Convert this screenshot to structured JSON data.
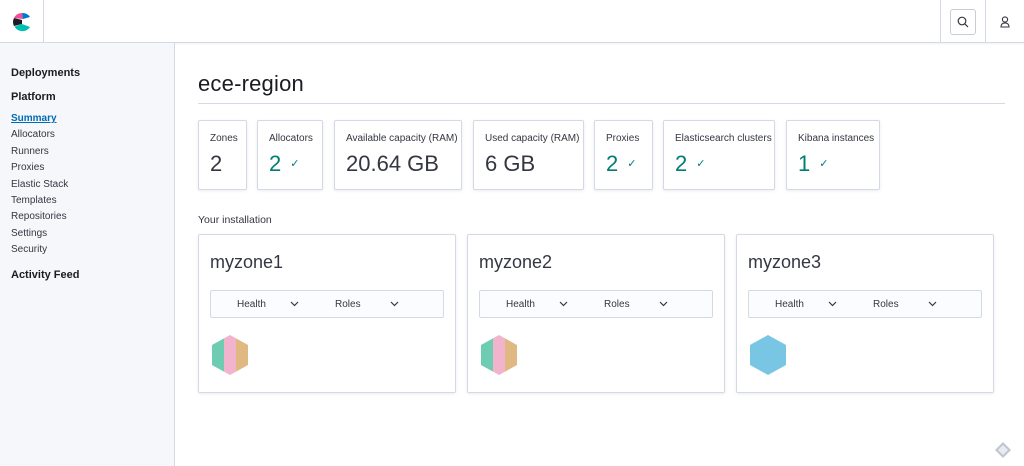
{
  "header": {
    "logo_icon": "elastic-cloud-logo",
    "search_icon": "search-icon",
    "user_icon": "user-icon"
  },
  "sidebar": {
    "sections": {
      "deployments": "Deployments",
      "platform": "Platform",
      "activity_feed": "Activity Feed"
    },
    "items": [
      {
        "label": "Summary",
        "active": true
      },
      {
        "label": "Allocators"
      },
      {
        "label": "Runners"
      },
      {
        "label": "Proxies"
      },
      {
        "label": "Elastic Stack"
      },
      {
        "label": "Templates"
      },
      {
        "label": "Repositories"
      },
      {
        "label": "Settings"
      },
      {
        "label": "Security"
      }
    ]
  },
  "main": {
    "title": "ece-region",
    "stats": [
      {
        "label": "Zones",
        "value": "2",
        "healthy": false
      },
      {
        "label": "Allocators",
        "value": "2",
        "healthy": true
      },
      {
        "label": "Available capacity (RAM)",
        "value": "20.64 GB",
        "healthy": false
      },
      {
        "label": "Used capacity (RAM)",
        "value": "6 GB",
        "healthy": false
      },
      {
        "label": "Proxies",
        "value": "2",
        "healthy": true
      },
      {
        "label": "Elasticsearch clusters",
        "value": "2",
        "healthy": true
      },
      {
        "label": "Kibana instances",
        "value": "1",
        "healthy": true
      }
    ],
    "installation_label": "Your installation",
    "zones": [
      {
        "name": "myzone1",
        "health_label": "Health",
        "roles_label": "Roles",
        "hex_colors": [
          "#6dccb1",
          "#f1b4cc",
          "#e0b881"
        ]
      },
      {
        "name": "myzone2",
        "health_label": "Health",
        "roles_label": "Roles",
        "hex_colors": [
          "#6dccb1",
          "#f1b4cc",
          "#e0b881"
        ]
      },
      {
        "name": "myzone3",
        "health_label": "Health",
        "roles_label": "Roles",
        "hex_colors": [
          "#79c6e4"
        ]
      }
    ]
  },
  "colors": {
    "accent": "#006bb4",
    "healthy": "#017d73",
    "border": "#d3dae6",
    "sidebar_bg": "#f5f7fa"
  }
}
